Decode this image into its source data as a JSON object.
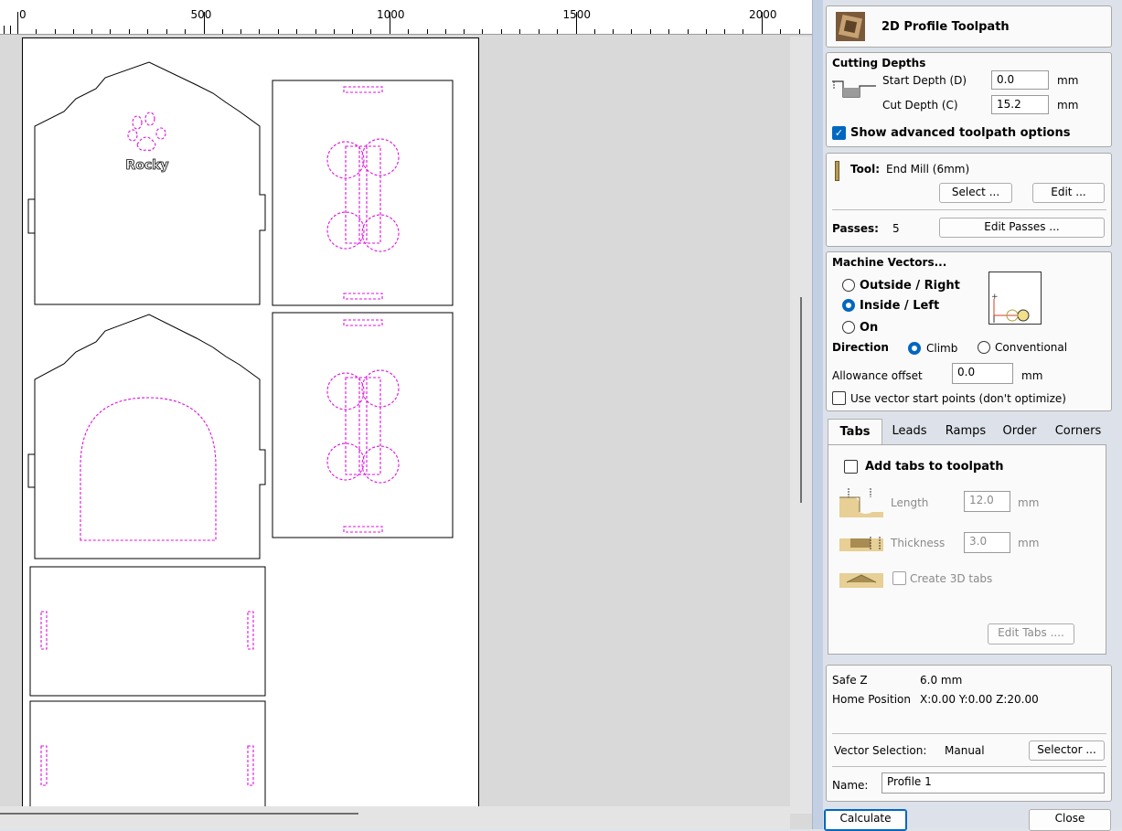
{
  "ruler": {
    "labels": [
      "0",
      "500",
      "1000",
      "1500",
      "2000"
    ]
  },
  "drawing": {
    "name_text": "Rocky"
  },
  "panel": {
    "title": "2D Profile Toolpath",
    "cutting_depths": {
      "heading": "Cutting Depths",
      "start_label": "Start Depth (D)",
      "start_value": "0.0",
      "cut_label": "Cut Depth (C)",
      "cut_value": "15.2",
      "unit": "mm",
      "advanced_label": "Show advanced toolpath options",
      "advanced_checked": true
    },
    "tool": {
      "label": "Tool:",
      "value": "End Mill (6mm)",
      "select_button": "Select ...",
      "edit_button": "Edit ...",
      "passes_label": "Passes:",
      "passes_value": "5",
      "edit_passes_button": "Edit Passes ..."
    },
    "machine_vectors": {
      "heading": "Machine Vectors...",
      "options": [
        "Outside / Right",
        "Inside / Left",
        "On"
      ],
      "selected": "Inside / Left",
      "direction_label": "Direction",
      "direction_options": [
        "Climb",
        "Conventional"
      ],
      "direction_selected": "Climb",
      "allowance_label": "Allowance offset",
      "allowance_value": "0.0",
      "unit": "mm",
      "start_points_label": "Use vector start points (don't optimize)",
      "start_points_checked": false
    },
    "tabs": {
      "names": [
        "Tabs",
        "Leads",
        "Ramps",
        "Order",
        "Corners"
      ],
      "active": "Tabs",
      "add_tabs_label": "Add tabs to toolpath",
      "add_tabs_checked": false,
      "length_label": "Length",
      "length_value": "12.0",
      "thickness_label": "Thickness",
      "thickness_value": "3.0",
      "unit": "mm",
      "create3d_label": "Create 3D tabs",
      "edit_tabs_button": "Edit Tabs ...."
    },
    "info": {
      "safe_z_label": "Safe Z",
      "safe_z_value": "6.0 mm",
      "home_label": "Home Position",
      "home_value": "X:0.00 Y:0.00 Z:20.00"
    },
    "vector_selection": {
      "label": "Vector Selection:",
      "value": "Manual",
      "button": "Selector ..."
    },
    "name": {
      "label": "Name:",
      "value": "Profile 1"
    },
    "calculate_button": "Calculate",
    "close_button": "Close"
  },
  "colors": {
    "accent": "#0067c0",
    "toolpath": "#e010e0",
    "panel_bg": "#dde2ea"
  }
}
